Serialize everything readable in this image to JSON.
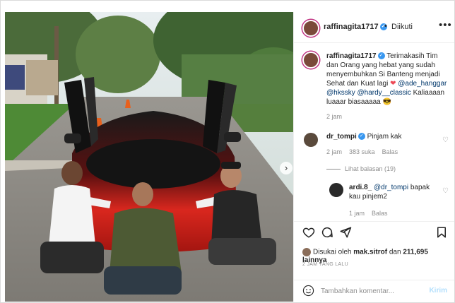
{
  "post": {
    "username": "raffinagita1717",
    "follow_state": "Diikuti",
    "caption": {
      "username": "raffinagita1717",
      "text": "Terimakasih Tim dan Orang yang hebat yang sudah menyembuhkan Si Banteng menjadi Sehat dan Kuat lagi",
      "mentions": "@ade_hanggar @hkssky @hardy__classic",
      "closing": "Kaliaaaan luaaar biasaaaaa",
      "time": "2 jam"
    },
    "comments": [
      {
        "username": "dr_tompi",
        "text": "Pinjam kak",
        "time": "2 jam",
        "likes": "383 suka",
        "reply": "Balas",
        "view_replies": "Lihat balasan (19)"
      },
      {
        "username": "ardi.8_",
        "mention": "@dr_tompi",
        "text": "bapak kau pinjem2",
        "time": "1 jam",
        "reply": "Balas"
      }
    ],
    "liked_by": {
      "prefix": "Disukai oleh",
      "user": "mak.sitrof",
      "middle": "dan",
      "count": "211,695 lainnya"
    },
    "timestamp": "2 JAM YANG LALU",
    "comment_placeholder": "Tambahkan komentar...",
    "post_button": "Kirim"
  },
  "icons": [
    "heart-icon",
    "comment-icon",
    "share-icon",
    "bookmark-icon",
    "emoji-icon",
    "more-icon",
    "next-arrow-icon",
    "verified-icon"
  ],
  "colors": {
    "link": "#00376b",
    "verified": "#3897f0",
    "post_disabled": "#b2dffc",
    "heart": "#ed4956"
  }
}
